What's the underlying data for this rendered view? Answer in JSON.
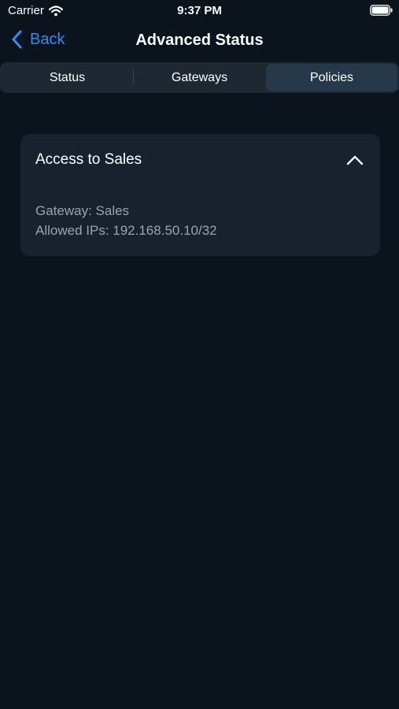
{
  "status_bar": {
    "carrier": "Carrier",
    "time": "9:37 PM"
  },
  "nav": {
    "back_label": "Back",
    "title": "Advanced Status"
  },
  "tabs": [
    {
      "label": "Status",
      "selected": false
    },
    {
      "label": "Gateways",
      "selected": false
    },
    {
      "label": "Policies",
      "selected": true
    }
  ],
  "policy_card": {
    "title": "Access to Sales",
    "gateway": "Gateway: Sales",
    "allowed_ips": "Allowed IPs: 192.168.50.10/32",
    "expanded": true
  },
  "colors": {
    "background": "#0b141d",
    "accent": "#2f8cf0",
    "card": "#18222e",
    "segment_selected": "#26394a"
  },
  "icons": [
    "wifi-icon",
    "battery-icon",
    "chevron-left-icon",
    "chevron-up-icon"
  ]
}
